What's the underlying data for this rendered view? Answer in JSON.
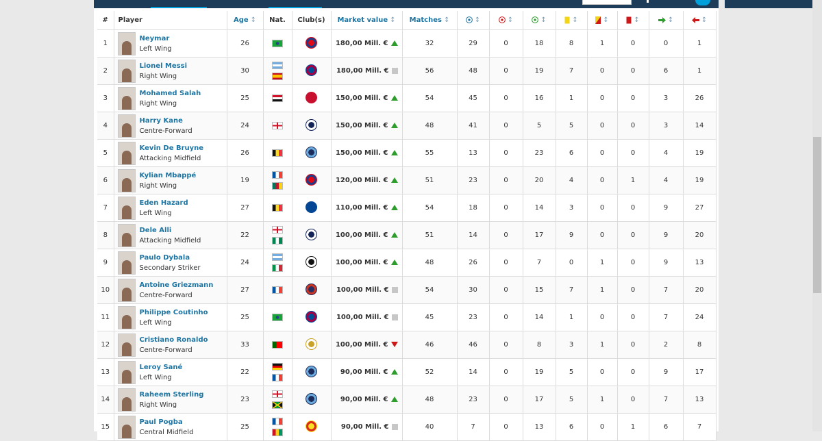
{
  "table": {
    "headers": {
      "rank": "#",
      "player": "Player",
      "age": "Age",
      "nat": "Nat.",
      "club": "Club(s)",
      "market_value": "Market value",
      "matches": "Matches"
    },
    "sort_arrow": "↕",
    "rows": [
      {
        "rank": "1",
        "name": "Neymar",
        "position": "Left Wing",
        "age": "26",
        "flags": [
          "brazil"
        ],
        "club": "psg",
        "market_value": "180,00 Mill. €",
        "trend": "up",
        "matches": "32",
        "goals": "29",
        "own_goals": "0",
        "assists": "18",
        "yellow": "8",
        "second_yellow": "1",
        "red": "0",
        "subbed_on": "0",
        "subbed_off": "1"
      },
      {
        "rank": "2",
        "name": "Lionel Messi",
        "position": "Right Wing",
        "age": "30",
        "flags": [
          "argentina",
          "spain"
        ],
        "club": "barcelona",
        "market_value": "180,00 Mill. €",
        "trend": "equal",
        "matches": "56",
        "goals": "48",
        "own_goals": "0",
        "assists": "19",
        "yellow": "7",
        "second_yellow": "0",
        "red": "0",
        "subbed_on": "6",
        "subbed_off": "1"
      },
      {
        "rank": "3",
        "name": "Mohamed Salah",
        "position": "Right Wing",
        "age": "25",
        "flags": [
          "egypt"
        ],
        "club": "liverpool",
        "market_value": "150,00 Mill. €",
        "trend": "up",
        "matches": "54",
        "goals": "45",
        "own_goals": "0",
        "assists": "16",
        "yellow": "1",
        "second_yellow": "0",
        "red": "0",
        "subbed_on": "3",
        "subbed_off": "26"
      },
      {
        "rank": "4",
        "name": "Harry Kane",
        "position": "Centre-Forward",
        "age": "24",
        "flags": [
          "england"
        ],
        "club": "tottenham",
        "market_value": "150,00 Mill. €",
        "trend": "up",
        "matches": "48",
        "goals": "41",
        "own_goals": "0",
        "assists": "5",
        "yellow": "5",
        "second_yellow": "0",
        "red": "0",
        "subbed_on": "3",
        "subbed_off": "14"
      },
      {
        "rank": "5",
        "name": "Kevin De Bruyne",
        "position": "Attacking Midfield",
        "age": "26",
        "flags": [
          "belgium"
        ],
        "club": "mancity",
        "market_value": "150,00 Mill. €",
        "trend": "up",
        "matches": "55",
        "goals": "13",
        "own_goals": "0",
        "assists": "23",
        "yellow": "6",
        "second_yellow": "0",
        "red": "0",
        "subbed_on": "4",
        "subbed_off": "19"
      },
      {
        "rank": "6",
        "name": "Kylian Mbappé",
        "position": "Right Wing",
        "age": "19",
        "flags": [
          "france",
          "cameroon"
        ],
        "club": "psg",
        "market_value": "120,00 Mill. €",
        "trend": "up",
        "matches": "51",
        "goals": "23",
        "own_goals": "0",
        "assists": "20",
        "yellow": "4",
        "second_yellow": "0",
        "red": "1",
        "subbed_on": "4",
        "subbed_off": "19"
      },
      {
        "rank": "7",
        "name": "Eden Hazard",
        "position": "Left Wing",
        "age": "27",
        "flags": [
          "belgium"
        ],
        "club": "chelsea",
        "market_value": "110,00 Mill. €",
        "trend": "up",
        "matches": "54",
        "goals": "18",
        "own_goals": "0",
        "assists": "14",
        "yellow": "3",
        "second_yellow": "0",
        "red": "0",
        "subbed_on": "9",
        "subbed_off": "27"
      },
      {
        "rank": "8",
        "name": "Dele Alli",
        "position": "Attacking Midfield",
        "age": "22",
        "flags": [
          "england",
          "nigeria"
        ],
        "club": "tottenham",
        "market_value": "100,00 Mill. €",
        "trend": "up",
        "matches": "51",
        "goals": "14",
        "own_goals": "0",
        "assists": "17",
        "yellow": "9",
        "second_yellow": "0",
        "red": "0",
        "subbed_on": "9",
        "subbed_off": "20"
      },
      {
        "rank": "9",
        "name": "Paulo Dybala",
        "position": "Secondary Striker",
        "age": "24",
        "flags": [
          "argentina",
          "italy"
        ],
        "club": "juventus",
        "market_value": "100,00 Mill. €",
        "trend": "up",
        "matches": "48",
        "goals": "26",
        "own_goals": "0",
        "assists": "7",
        "yellow": "0",
        "second_yellow": "1",
        "red": "0",
        "subbed_on": "9",
        "subbed_off": "13"
      },
      {
        "rank": "10",
        "name": "Antoine Griezmann",
        "position": "Centre-Forward",
        "age": "27",
        "flags": [
          "france"
        ],
        "club": "atletico",
        "market_value": "100,00 Mill. €",
        "trend": "equal",
        "matches": "54",
        "goals": "30",
        "own_goals": "0",
        "assists": "15",
        "yellow": "7",
        "second_yellow": "1",
        "red": "0",
        "subbed_on": "7",
        "subbed_off": "20"
      },
      {
        "rank": "11",
        "name": "Philippe Coutinho",
        "position": "Left Wing",
        "age": "25",
        "flags": [
          "brazil"
        ],
        "club": "barcelona",
        "market_value": "100,00 Mill. €",
        "trend": "equal",
        "matches": "45",
        "goals": "23",
        "own_goals": "0",
        "assists": "14",
        "yellow": "1",
        "second_yellow": "0",
        "red": "0",
        "subbed_on": "7",
        "subbed_off": "24"
      },
      {
        "rank": "12",
        "name": "Cristiano Ronaldo",
        "position": "Centre-Forward",
        "age": "33",
        "flags": [
          "portugal"
        ],
        "club": "realmadrid",
        "market_value": "100,00 Mill. €",
        "trend": "down",
        "matches": "46",
        "goals": "46",
        "own_goals": "0",
        "assists": "8",
        "yellow": "3",
        "second_yellow": "1",
        "red": "0",
        "subbed_on": "2",
        "subbed_off": "8"
      },
      {
        "rank": "13",
        "name": "Leroy Sané",
        "position": "Left Wing",
        "age": "22",
        "flags": [
          "germany",
          "france"
        ],
        "club": "mancity",
        "market_value": "90,00 Mill. €",
        "trend": "up",
        "matches": "52",
        "goals": "14",
        "own_goals": "0",
        "assists": "19",
        "yellow": "5",
        "second_yellow": "0",
        "red": "0",
        "subbed_on": "9",
        "subbed_off": "17"
      },
      {
        "rank": "14",
        "name": "Raheem Sterling",
        "position": "Right Wing",
        "age": "23",
        "flags": [
          "england",
          "jamaica"
        ],
        "club": "mancity",
        "market_value": "90,00 Mill. €",
        "trend": "up",
        "matches": "48",
        "goals": "23",
        "own_goals": "0",
        "assists": "17",
        "yellow": "5",
        "second_yellow": "1",
        "red": "0",
        "subbed_on": "7",
        "subbed_off": "13"
      },
      {
        "rank": "15",
        "name": "Paul Pogba",
        "position": "Central Midfield",
        "age": "25",
        "flags": [
          "france",
          "guinea"
        ],
        "club": "manutd",
        "market_value": "90,00 Mill. €",
        "trend": "equal",
        "matches": "40",
        "goals": "7",
        "own_goals": "0",
        "assists": "13",
        "yellow": "6",
        "second_yellow": "0",
        "red": "1",
        "subbed_on": "6",
        "subbed_off": "7"
      }
    ]
  }
}
